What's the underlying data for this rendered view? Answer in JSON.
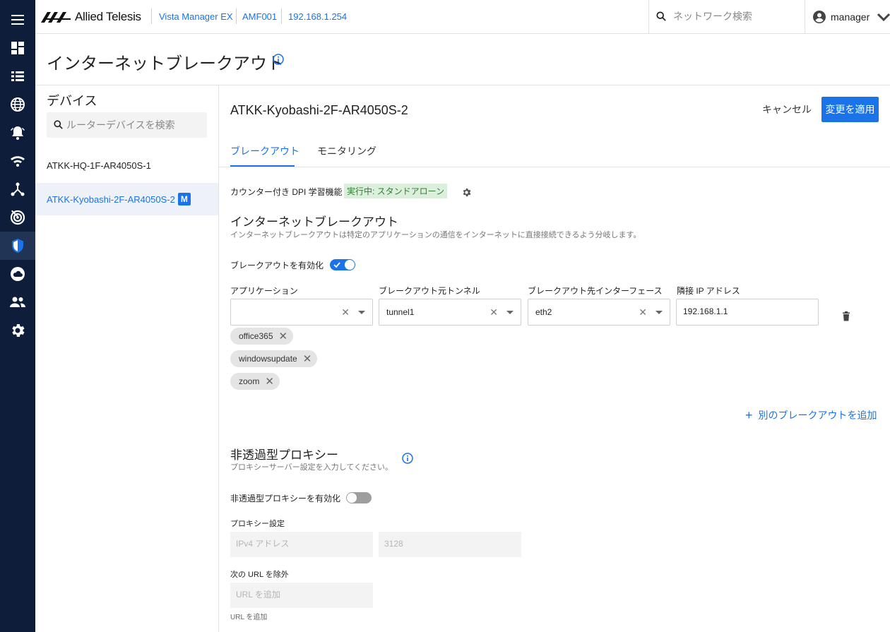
{
  "topbar": {
    "brand": "Allied Telesis",
    "product": "Vista Manager EX",
    "area": "AMF001",
    "ip": "192.168.1.254",
    "search_placeholder": "ネットワーク検索",
    "user": "manager"
  },
  "rail": {
    "items": [
      "menu-icon",
      "dashboard-icon",
      "list-icon",
      "globe-icon",
      "alarm-icon",
      "wifi-icon",
      "topology-icon",
      "radar-icon",
      "shield-icon",
      "cloud-icon",
      "people-icon",
      "gear-icon"
    ],
    "active": "shield-icon"
  },
  "page": {
    "title": "インターネットブレークアウト"
  },
  "devices": {
    "title": "デバイス",
    "search_placeholder": "ルーターデバイスを検索",
    "items": [
      {
        "name": "ATKK-HQ-1F-AR4050S-1",
        "badge": ""
      },
      {
        "name": "ATKK-Kyobashi-2F-AR4050S-2",
        "badge": "M"
      }
    ]
  },
  "main": {
    "device_name": "ATKK-Kyobashi-2F-AR4050S-2",
    "cancel_label": "キャンセル",
    "apply_label": "変更を適用",
    "tabs": [
      "ブレークアウト",
      "モニタリング"
    ],
    "dpi": {
      "label": "カウンター付き DPI 学習機能",
      "status": "実行中: スタンドアローン"
    },
    "breakout": {
      "title": "インターネットブレークアウト",
      "description": "インターネットブレークアウトは特定のアプリケーションの通信をインターネットに直接接続できるよう分岐します。",
      "enable_label": "ブレークアウトを有効化",
      "enabled": true,
      "columns": [
        "アプリケーション",
        "ブレークアウト元トンネル",
        "ブレークアウト先インターフェース",
        "隣接 IP アドレス"
      ],
      "application_value": "",
      "tunnel_value": "tunnel1",
      "interface_value": "eth2",
      "neighbor_ip": "192.168.1.1",
      "apps": [
        "office365",
        "windowsupdate",
        "zoom"
      ],
      "add_label": "別のブレークアウトを追加"
    },
    "proxy": {
      "title": "非透過型プロキシー",
      "description": "プロキシーサーバー設定を入力してください。",
      "enable_label": "非透過型プロキシーを有効化",
      "enabled": false,
      "settings_label": "プロキシー設定",
      "ipv4_placeholder": "IPv4 アドレス",
      "port_placeholder": "3128",
      "exclude_label": "次の URL を除外",
      "url_placeholder": "URL を追加",
      "url_hint": "URL を追加"
    }
  },
  "colors": {
    "accent": "#1a73e8",
    "rail": "#0e1e3a",
    "status_bg": "#dcefdc",
    "status_fg": "#2e7d32"
  }
}
